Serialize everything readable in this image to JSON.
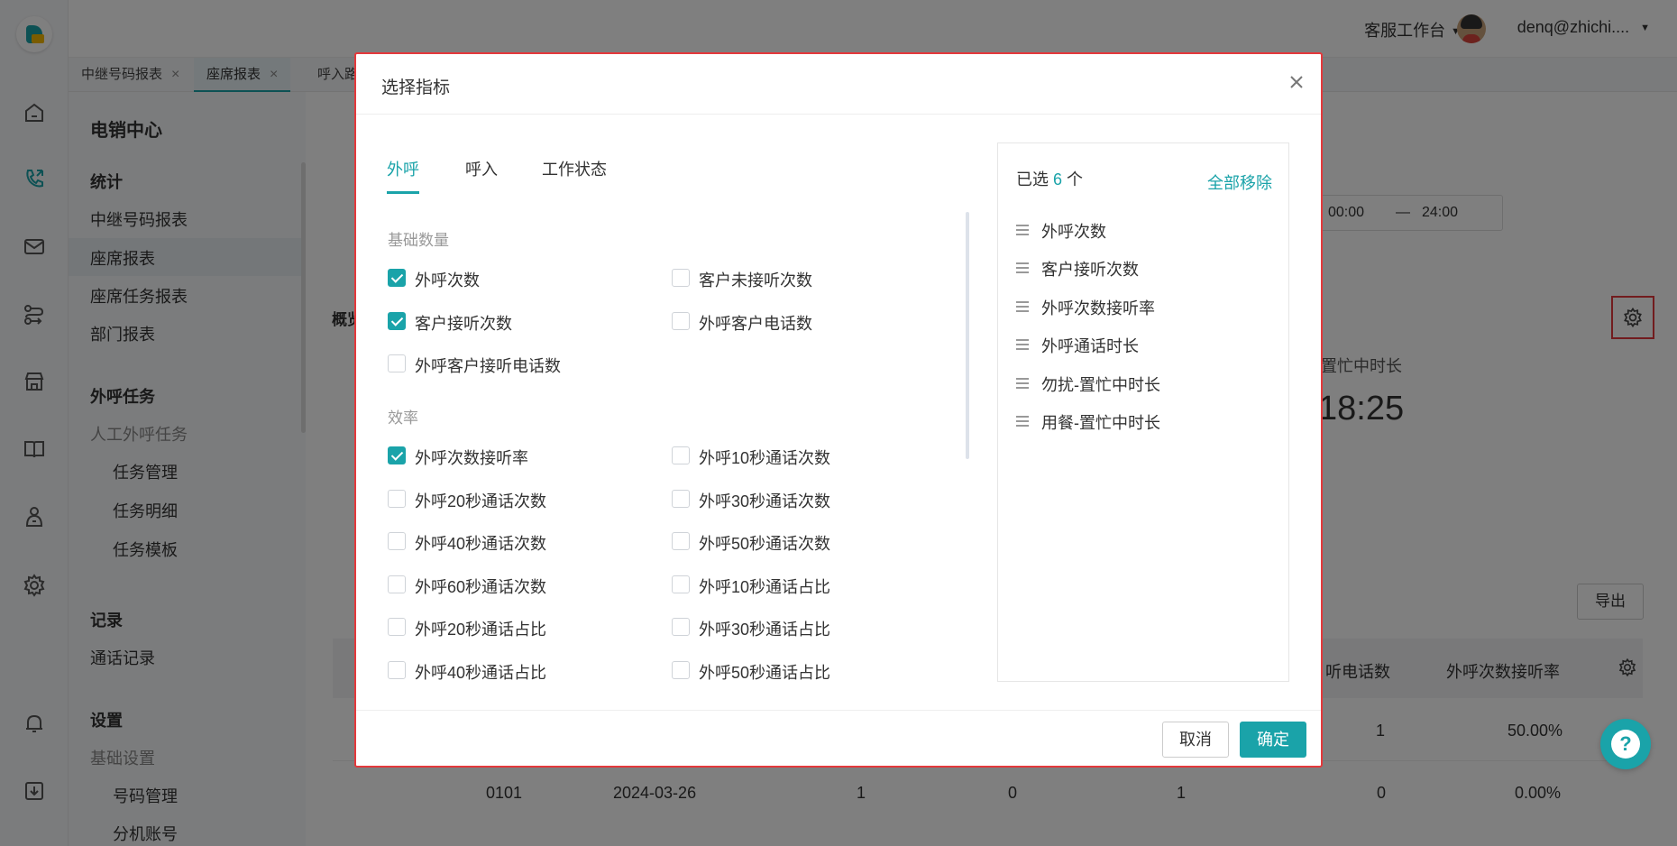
{
  "header": {
    "workspace_label": "客服工作台",
    "user_label": "denq@zhichi...."
  },
  "tabs": [
    {
      "label": "中继号码报表"
    },
    {
      "label": "座席报表"
    },
    {
      "label": "呼入路由"
    }
  ],
  "sidebar": {
    "title": "电销中心",
    "groups": {
      "stats": "统计",
      "trunk_report": "中继号码报表",
      "agent_report": "座席报表",
      "agent_task_report": "座席任务报表",
      "dept_report": "部门报表",
      "outbound_tasks": "外呼任务",
      "manual_outbound": "人工外呼任务",
      "task_manage": "任务管理",
      "task_detail": "任务明细",
      "task_template": "任务模板",
      "records": "记录",
      "call_records": "通话记录",
      "settings": "设置",
      "basic_settings": "基础设置",
      "number_manage": "号码管理",
      "ext_account": "分机账号"
    }
  },
  "background": {
    "overview_label": "概览",
    "time_start": "00:00",
    "time_sep": "—",
    "time_end": "24:00",
    "busy_label": "置忙中时长",
    "busy_value": "18:25",
    "export_label": "导出",
    "col_answered_calls": "听电话数",
    "col_answer_rate": "外呼次数接听率",
    "row1": {
      "v1": "1",
      "v2": "50.00%"
    },
    "row2": {
      "id": "0101",
      "date": "2024-03-26",
      "c1": "1",
      "c2": "0",
      "c3": "1",
      "c4": "0",
      "c5": "0.00%"
    }
  },
  "modal": {
    "title": "选择指标",
    "tabs": [
      "外呼",
      "呼入",
      "工作状态"
    ],
    "sections": {
      "basic": "基础数量",
      "efficiency": "效率"
    },
    "options": [
      {
        "label": "外呼次数",
        "checked": true
      },
      {
        "label": "客户未接听次数",
        "checked": false
      },
      {
        "label": "客户接听次数",
        "checked": true
      },
      {
        "label": "外呼客户电话数",
        "checked": false
      },
      {
        "label": "外呼客户接听电话数",
        "checked": false
      },
      {
        "label": "外呼次数接听率",
        "checked": true
      },
      {
        "label": "外呼10秒通话次数",
        "checked": false
      },
      {
        "label": "外呼20秒通话次数",
        "checked": false
      },
      {
        "label": "外呼30秒通话次数",
        "checked": false
      },
      {
        "label": "外呼40秒通话次数",
        "checked": false
      },
      {
        "label": "外呼50秒通话次数",
        "checked": false
      },
      {
        "label": "外呼60秒通话次数",
        "checked": false
      },
      {
        "label": "外呼10秒通话占比",
        "checked": false
      },
      {
        "label": "外呼20秒通话占比",
        "checked": false
      },
      {
        "label": "外呼30秒通话占比",
        "checked": false
      },
      {
        "label": "外呼40秒通话占比",
        "checked": false
      },
      {
        "label": "外呼50秒通话占比",
        "checked": false
      }
    ],
    "selected_prefix": "已选",
    "selected_count": "6",
    "selected_suffix": "个",
    "clear_all": "全部移除",
    "selected_items": [
      "外呼次数",
      "客户接听次数",
      "外呼次数接听率",
      "外呼通话时长",
      "勿扰-置忙中时长",
      "用餐-置忙中时长"
    ],
    "cancel": "取消",
    "confirm": "确定"
  },
  "icons": {
    "rail": [
      "home-icon",
      "phone-icon",
      "mail-icon",
      "route-icon",
      "store-icon",
      "book-icon",
      "money-user-icon",
      "gear-icon",
      "bell-icon",
      "download-icon"
    ],
    "accent_color": "#1aa3a9",
    "highlight_color": "#e4393c"
  }
}
